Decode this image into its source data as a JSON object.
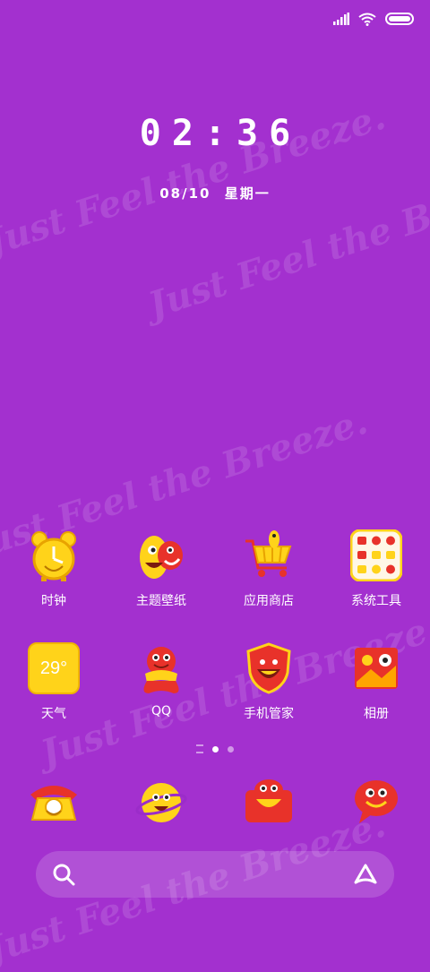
{
  "status_bar": {
    "signal_icon": "signal-bars-icon",
    "wifi_icon": "wifi-icon",
    "battery_icon": "battery-icon",
    "battery_level": 1.0
  },
  "lockscreen": {
    "time_hours": "02",
    "time_sep": ":",
    "time_minutes": "36",
    "date": "08/10",
    "weekday": "星期一"
  },
  "watermark": {
    "text": "Just Feel the Breeze."
  },
  "apps_row1": [
    {
      "label": "时钟",
      "icon": "alarm-clock-icon"
    },
    {
      "label": "主题壁纸",
      "icon": "theme-wallpaper-icon"
    },
    {
      "label": "应用商店",
      "icon": "shopping-cart-icon"
    },
    {
      "label": "系统工具",
      "icon": "tools-folder-icon"
    }
  ],
  "apps_row2": [
    {
      "label": "天气",
      "icon": "weather-icon",
      "value": "29°"
    },
    {
      "label": "QQ",
      "icon": "qq-icon"
    },
    {
      "label": "手机管家",
      "icon": "shield-icon"
    },
    {
      "label": "相册",
      "icon": "gallery-icon"
    }
  ],
  "dock": [
    {
      "icon": "phone-icon"
    },
    {
      "icon": "browser-planet-icon"
    },
    {
      "icon": "camera-icon"
    },
    {
      "icon": "messages-icon"
    }
  ],
  "pager": {
    "pages": 3,
    "current": 2
  },
  "search_bar": {
    "search_icon": "search-icon",
    "assistant_icon": "assistant-icon"
  },
  "colors": {
    "background": "#A330CF",
    "yellow": "#FFD31A",
    "red": "#E8322A"
  }
}
